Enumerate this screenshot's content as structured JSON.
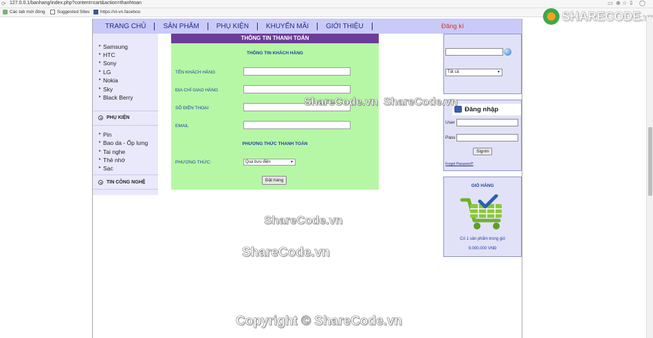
{
  "browser": {
    "url": "127.0.0.1/banhang/index.php?content=cart&action=thanhtoan",
    "bookmarks": [
      {
        "label": "Các tab mới đóng"
      },
      {
        "label": "Suggested Sites"
      },
      {
        "label": "https://vi-vn.faceboo"
      }
    ]
  },
  "watermark": {
    "logo": "SHARECODE",
    "logo_suffix": ".vn",
    "center_1": "ShareCode.vn",
    "center_2": "ShareCode.vn",
    "form_1": "ShareCode.vn",
    "form_2": "ShareCode.vn",
    "copyright": "Copyright © ShareCode.vn"
  },
  "nav": {
    "items": [
      "TRANG CHỦ",
      "SẢN PHẨM",
      "PHỤ KIỆN",
      "KHUYẾN MÃI",
      "GIỚI THIỆU"
    ],
    "register": "Đăng kí"
  },
  "sidebar": {
    "brands": [
      "Samsung",
      "HTC",
      "Sony",
      "LG",
      "Nokia",
      "Sky",
      "Black Berry"
    ],
    "accessories_title": "PHỤ KIỆN",
    "accessories": [
      "Pin",
      "Bao da - Ốp lưng",
      "Tai nghe",
      "Thẻ nhớ",
      "Sạc"
    ],
    "news_title": "TIN CÔNG NGHỆ"
  },
  "form": {
    "header": "THÔNG TIN THANH TOÁN",
    "customer_title": "THÔNG TIN KHÁCH HÀNG",
    "name_label": "TÊN KHÁCH HÀNG",
    "address_label": "ĐỊA CHỈ GIAO HÀNG",
    "phone_label": "SỐ ĐIỆN THOẠI",
    "email_label": "EMAIL",
    "payment_title": "PHƯƠNG THỨC THANH TOÁN",
    "method_label": "PHƯƠNG THỨC:",
    "method_value": "Qua bưu điện",
    "submit": "Đặt hàng"
  },
  "search": {
    "category_value": "Tất cả"
  },
  "login": {
    "title": "Đăng nhập",
    "user_label": "User",
    "pass_label": "Pass",
    "button": "SignIn",
    "forgot": "Forget Password?"
  },
  "cart": {
    "title": "GIỎ HÀNG",
    "count_text": "Có 1 sản phẩm trong giỏ",
    "total": "9.000.000 VNĐ"
  }
}
